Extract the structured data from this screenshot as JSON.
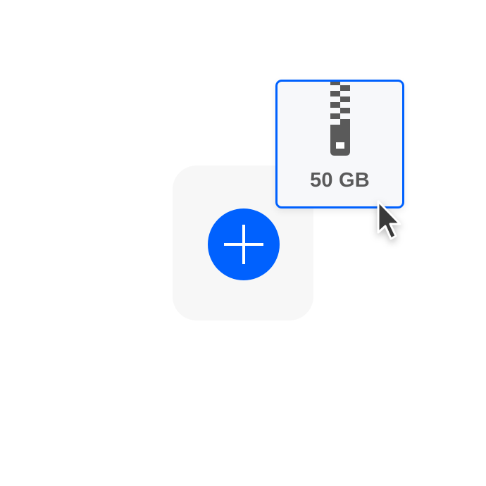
{
  "drop_zone": {
    "add_button_icon": "plus-icon"
  },
  "file_card": {
    "icon": "zip-file-icon",
    "size_label": "50 GB"
  },
  "cursor": {
    "icon": "pointer-cursor-icon"
  },
  "colors": {
    "accent": "#0061fe",
    "drop_zone_bg": "#f7f7f7",
    "card_bg": "#f7f8fa",
    "icon_gray": "#5a5a5a"
  }
}
